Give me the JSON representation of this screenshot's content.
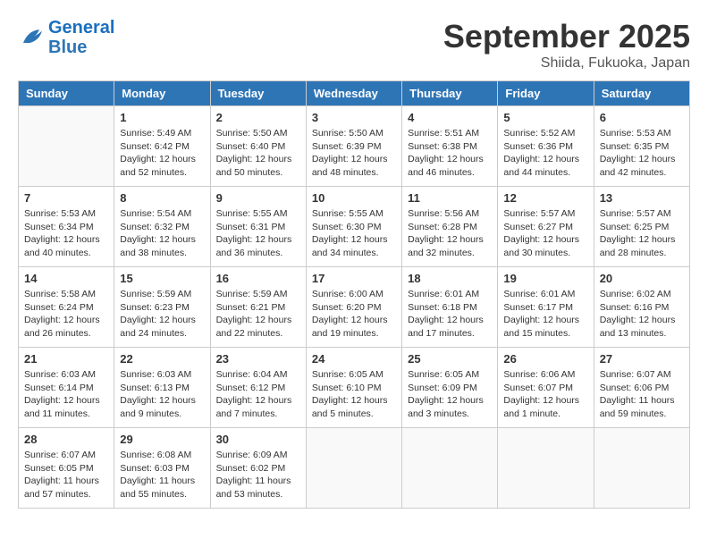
{
  "header": {
    "logo_line1": "General",
    "logo_line2": "Blue",
    "month": "September 2025",
    "location": "Shiida, Fukuoka, Japan"
  },
  "weekdays": [
    "Sunday",
    "Monday",
    "Tuesday",
    "Wednesday",
    "Thursday",
    "Friday",
    "Saturday"
  ],
  "weeks": [
    [
      {
        "day": null
      },
      {
        "day": "1",
        "sunrise": "5:49 AM",
        "sunset": "6:42 PM",
        "daylight": "12 hours and 52 minutes."
      },
      {
        "day": "2",
        "sunrise": "5:50 AM",
        "sunset": "6:40 PM",
        "daylight": "12 hours and 50 minutes."
      },
      {
        "day": "3",
        "sunrise": "5:50 AM",
        "sunset": "6:39 PM",
        "daylight": "12 hours and 48 minutes."
      },
      {
        "day": "4",
        "sunrise": "5:51 AM",
        "sunset": "6:38 PM",
        "daylight": "12 hours and 46 minutes."
      },
      {
        "day": "5",
        "sunrise": "5:52 AM",
        "sunset": "6:36 PM",
        "daylight": "12 hours and 44 minutes."
      },
      {
        "day": "6",
        "sunrise": "5:53 AM",
        "sunset": "6:35 PM",
        "daylight": "12 hours and 42 minutes."
      }
    ],
    [
      {
        "day": "7",
        "sunrise": "5:53 AM",
        "sunset": "6:34 PM",
        "daylight": "12 hours and 40 minutes."
      },
      {
        "day": "8",
        "sunrise": "5:54 AM",
        "sunset": "6:32 PM",
        "daylight": "12 hours and 38 minutes."
      },
      {
        "day": "9",
        "sunrise": "5:55 AM",
        "sunset": "6:31 PM",
        "daylight": "12 hours and 36 minutes."
      },
      {
        "day": "10",
        "sunrise": "5:55 AM",
        "sunset": "6:30 PM",
        "daylight": "12 hours and 34 minutes."
      },
      {
        "day": "11",
        "sunrise": "5:56 AM",
        "sunset": "6:28 PM",
        "daylight": "12 hours and 32 minutes."
      },
      {
        "day": "12",
        "sunrise": "5:57 AM",
        "sunset": "6:27 PM",
        "daylight": "12 hours and 30 minutes."
      },
      {
        "day": "13",
        "sunrise": "5:57 AM",
        "sunset": "6:25 PM",
        "daylight": "12 hours and 28 minutes."
      }
    ],
    [
      {
        "day": "14",
        "sunrise": "5:58 AM",
        "sunset": "6:24 PM",
        "daylight": "12 hours and 26 minutes."
      },
      {
        "day": "15",
        "sunrise": "5:59 AM",
        "sunset": "6:23 PM",
        "daylight": "12 hours and 24 minutes."
      },
      {
        "day": "16",
        "sunrise": "5:59 AM",
        "sunset": "6:21 PM",
        "daylight": "12 hours and 22 minutes."
      },
      {
        "day": "17",
        "sunrise": "6:00 AM",
        "sunset": "6:20 PM",
        "daylight": "12 hours and 19 minutes."
      },
      {
        "day": "18",
        "sunrise": "6:01 AM",
        "sunset": "6:18 PM",
        "daylight": "12 hours and 17 minutes."
      },
      {
        "day": "19",
        "sunrise": "6:01 AM",
        "sunset": "6:17 PM",
        "daylight": "12 hours and 15 minutes."
      },
      {
        "day": "20",
        "sunrise": "6:02 AM",
        "sunset": "6:16 PM",
        "daylight": "12 hours and 13 minutes."
      }
    ],
    [
      {
        "day": "21",
        "sunrise": "6:03 AM",
        "sunset": "6:14 PM",
        "daylight": "12 hours and 11 minutes."
      },
      {
        "day": "22",
        "sunrise": "6:03 AM",
        "sunset": "6:13 PM",
        "daylight": "12 hours and 9 minutes."
      },
      {
        "day": "23",
        "sunrise": "6:04 AM",
        "sunset": "6:12 PM",
        "daylight": "12 hours and 7 minutes."
      },
      {
        "day": "24",
        "sunrise": "6:05 AM",
        "sunset": "6:10 PM",
        "daylight": "12 hours and 5 minutes."
      },
      {
        "day": "25",
        "sunrise": "6:05 AM",
        "sunset": "6:09 PM",
        "daylight": "12 hours and 3 minutes."
      },
      {
        "day": "26",
        "sunrise": "6:06 AM",
        "sunset": "6:07 PM",
        "daylight": "12 hours and 1 minute."
      },
      {
        "day": "27",
        "sunrise": "6:07 AM",
        "sunset": "6:06 PM",
        "daylight": "11 hours and 59 minutes."
      }
    ],
    [
      {
        "day": "28",
        "sunrise": "6:07 AM",
        "sunset": "6:05 PM",
        "daylight": "11 hours and 57 minutes."
      },
      {
        "day": "29",
        "sunrise": "6:08 AM",
        "sunset": "6:03 PM",
        "daylight": "11 hours and 55 minutes."
      },
      {
        "day": "30",
        "sunrise": "6:09 AM",
        "sunset": "6:02 PM",
        "daylight": "11 hours and 53 minutes."
      },
      {
        "day": null
      },
      {
        "day": null
      },
      {
        "day": null
      },
      {
        "day": null
      }
    ]
  ]
}
